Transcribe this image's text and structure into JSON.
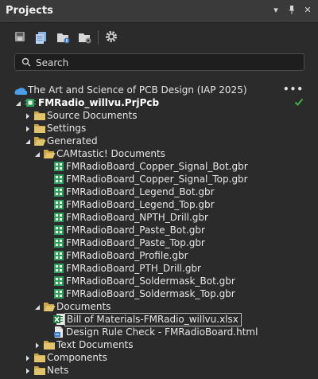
{
  "panel": {
    "title": "Projects"
  },
  "search": {
    "placeholder": "Search"
  },
  "tree": {
    "workspace": "The Art and Science of PCB Design (IAP 2025)",
    "project": "FMRadio_willvu.PrjPcb",
    "source_documents": "Source Documents",
    "settings": "Settings",
    "generated": "Generated",
    "camtastic": "CAMtastic! Documents",
    "gerber_files": [
      "FMRadioBoard_Copper_Signal_Bot.gbr",
      "FMRadioBoard_Copper_Signal_Top.gbr",
      "FMRadioBoard_Legend_Bot.gbr",
      "FMRadioBoard_Legend_Top.gbr",
      "FMRadioBoard_NPTH_Drill.gbr",
      "FMRadioBoard_Paste_Bot.gbr",
      "FMRadioBoard_Paste_Top.gbr",
      "FMRadioBoard_Profile.gbr",
      "FMRadioBoard_PTH_Drill.gbr",
      "FMRadioBoard_Soldermask_Bot.gbr",
      "FMRadioBoard_Soldermask_Top.gbr"
    ],
    "documents": "Documents",
    "bom_file": "Bill of Materials-FMRadio_willvu.xlsx",
    "drc_file": "Design Rule Check - FMRadioBoard.html",
    "text_documents": "Text Documents",
    "components": "Components",
    "nets": "Nets"
  },
  "colors": {
    "folder": "#c9a64a",
    "check": "#3fae49",
    "gerber": "#2f9e5a",
    "excel": "#1f7a3f",
    "html": "#3a78c8"
  }
}
